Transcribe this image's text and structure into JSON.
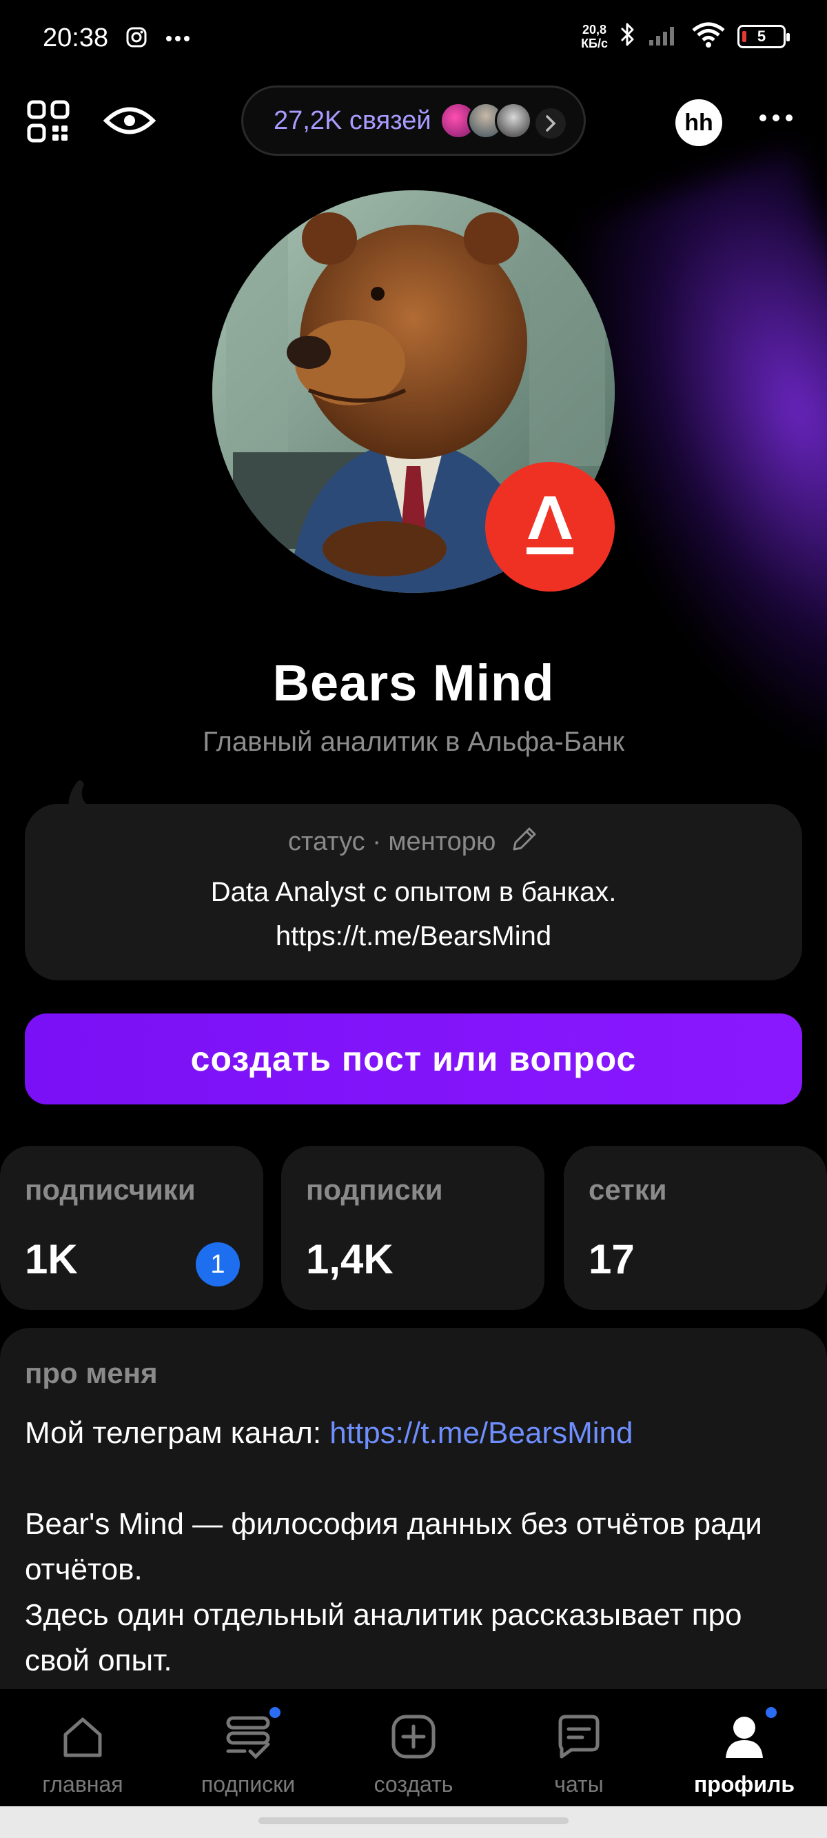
{
  "status_bar": {
    "time": "20:38",
    "net_speed_value": "20,8",
    "net_speed_unit": "КБ/с",
    "battery": "5"
  },
  "top_bar": {
    "connections": "27,2K связей"
  },
  "profile": {
    "name": "Bears Mind",
    "job": "Главный аналитик в Альфа-Банк",
    "badge_letter": "А"
  },
  "status_card": {
    "heading": "статус · менторю",
    "line1": "Data Analyst с опытом в банках.",
    "line2": "https://t.me/BearsMind"
  },
  "create_button": "создать пост или вопрос",
  "stats": [
    {
      "label": "подписчики",
      "value": "1K",
      "badge": "1"
    },
    {
      "label": "подписки",
      "value": "1,4K"
    },
    {
      "label": "сетки",
      "value": "17"
    }
  ],
  "about": {
    "title": "про меня",
    "telegram_prefix": "Мой телеграм канал: ",
    "telegram_link": "https://t.me/BearsMind",
    "para1": "Bear's Mind — философия данных без отчётов ради отчётов.",
    "para2": "Здесь один отдельный аналитик рассказывает про свой опыт."
  },
  "nav": {
    "home": "главная",
    "subscriptions": "подписки",
    "create": "создать",
    "chats": "чаты",
    "profile": "профиль"
  },
  "colors": {
    "accent": "#8a18ff",
    "link": "#6f8fff",
    "badge_blue": "#1e6ff0",
    "alfa_red": "#ef3124"
  }
}
